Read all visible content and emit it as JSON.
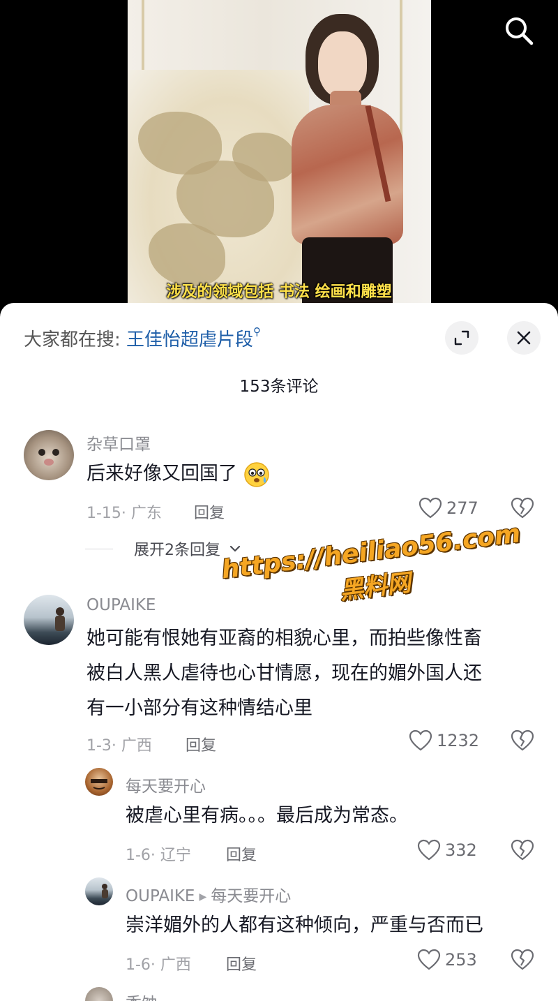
{
  "video": {
    "subtitle": "涉及的领域包括  书法  绘画和雕塑"
  },
  "sheet": {
    "hot_search_prefix": "大家都在搜:",
    "hot_search_keyword": "王佳怡超虐片段",
    "comment_count": "153条评论"
  },
  "comments": [
    {
      "username": "杂草口罩",
      "text": "后来好像又回国了",
      "date_location": "1-15· 广东",
      "reply_label": "回复",
      "likes": "277",
      "expand_replies": "展开2条回复"
    },
    {
      "username": "OUPAIKE",
      "text_lines": [
        "她可能有恨她有亚裔的相貌心里，而拍些像性畜",
        "被白人黑人虐待也心甘情愿，现在的媚外国人还",
        "有一小部分有这种情结心里"
      ],
      "date_location": "1-3· 广西",
      "reply_label": "回复",
      "likes": "1232"
    }
  ],
  "replies": [
    {
      "username": "每天要开心",
      "text": "被虐心里有病。。。最后成为常态。",
      "date_location": "1-6· 辽宁",
      "reply_label": "回复",
      "likes": "332"
    },
    {
      "username": "OUPAIKE",
      "reply_to": "每天要开心",
      "text": "崇洋媚外的人都有这种倾向，严重与否而已",
      "date_location": "1-6· 广西",
      "reply_label": "回复",
      "likes": "253"
    }
  ],
  "next_username_partial": "秃蚀",
  "watermark": {
    "url": "https://heiliao56.com",
    "text": "黑料网"
  },
  "colors": {
    "subtitle": "#ffe14a",
    "keyword_link": "#1e5ea8",
    "watermark": "#f5a623"
  },
  "icons": [
    "search-icon",
    "expand-icon",
    "close-icon",
    "heart-icon",
    "broken-heart-icon",
    "chevron-down-icon",
    "emoji-pleading-icon"
  ]
}
